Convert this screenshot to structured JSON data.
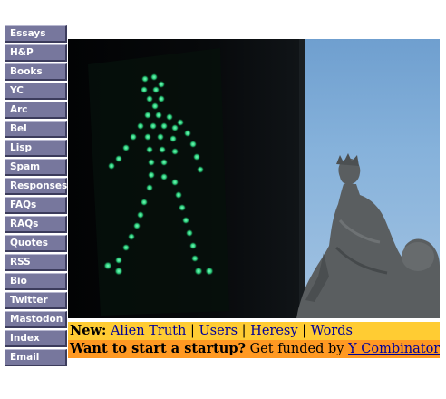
{
  "nav": {
    "items": [
      {
        "label": "Essays"
      },
      {
        "label": "H&P"
      },
      {
        "label": "Books"
      },
      {
        "label": "YC"
      },
      {
        "label": "Arc"
      },
      {
        "label": "Bel"
      },
      {
        "label": "Lisp"
      },
      {
        "label": "Spam"
      },
      {
        "label": "Responses"
      },
      {
        "label": "FAQs"
      },
      {
        "label": "RAQs"
      },
      {
        "label": "Quotes"
      },
      {
        "label": "RSS"
      },
      {
        "label": "Bio"
      },
      {
        "label": "Twitter"
      },
      {
        "label": "Mastodon"
      },
      {
        "label": "Index"
      },
      {
        "label": "Email"
      }
    ],
    "colors": {
      "button": "#77779d",
      "text": "#ffffff"
    }
  },
  "hero": {
    "icon": "walking-pedestrian-signal-icon",
    "colors": {
      "sky": "#86b2db",
      "signal": "#2ee88a",
      "statue": "#5a5e60"
    }
  },
  "news": {
    "prefix": "New:",
    "links": [
      "Alien Truth",
      "Users",
      "Heresy",
      "Words"
    ],
    "separator": "|",
    "color": "#ffcc33"
  },
  "startup": {
    "lead": "Want to start a startup?",
    "text": "Get funded by",
    "link": "Y Combinator",
    "color": "#ff9922"
  }
}
